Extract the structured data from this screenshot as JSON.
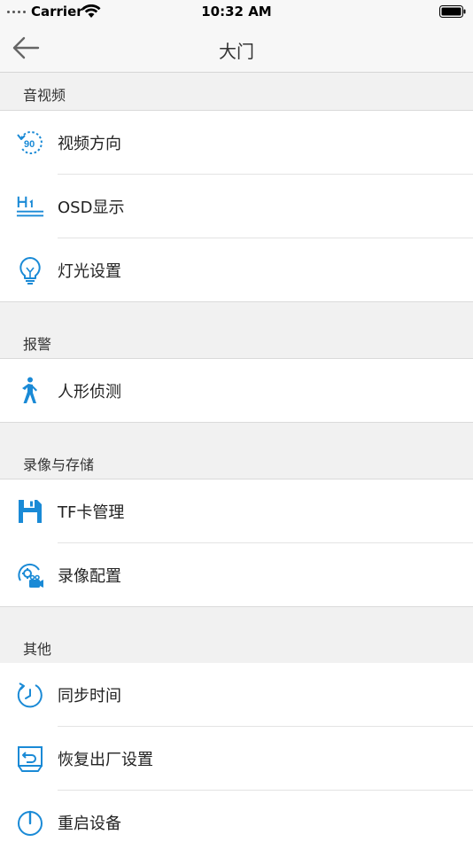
{
  "status_bar": {
    "carrier": "Carrier",
    "time": "10:32 AM"
  },
  "nav": {
    "title": "大门"
  },
  "sections": {
    "audio_video": {
      "header": "音视频",
      "items": [
        {
          "label": "视频方向",
          "icon": "rotate-90-icon"
        },
        {
          "label": "OSD显示",
          "icon": "heading-h1-icon"
        },
        {
          "label": "灯光设置",
          "icon": "lightbulb-icon"
        }
      ]
    },
    "alarm": {
      "header": "报警",
      "items": [
        {
          "label": "人形侦测",
          "icon": "walking-person-icon"
        }
      ]
    },
    "recording": {
      "header": "录像与存储",
      "items": [
        {
          "label": "TF卡管理",
          "icon": "floppy-disk-icon"
        },
        {
          "label": "录像配置",
          "icon": "camera-settings-icon"
        }
      ]
    },
    "other": {
      "header": "其他",
      "items": [
        {
          "label": "同步时间",
          "icon": "clock-sync-icon"
        },
        {
          "label": "恢复出厂设置",
          "icon": "factory-reset-icon"
        },
        {
          "label": "重启设备",
          "icon": "power-icon"
        }
      ]
    }
  },
  "colors": {
    "accent": "#1a8ad6",
    "background": "#f1f1f1",
    "row_background": "#ffffff"
  }
}
